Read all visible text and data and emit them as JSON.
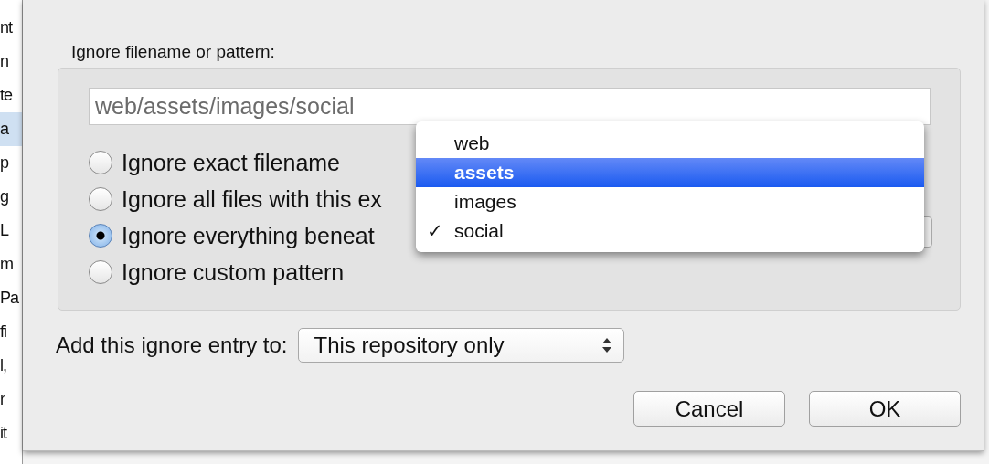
{
  "background_window": {
    "fragments": [
      {
        "text": "nt",
        "selected": false
      },
      {
        "text": "n",
        "selected": false
      },
      {
        "text": "te",
        "selected": false
      },
      {
        "text": "a",
        "selected": true
      },
      {
        "text": "p",
        "selected": false
      },
      {
        "text": "g",
        "selected": false
      },
      {
        "text": "L",
        "selected": false
      },
      {
        "text": "m",
        "selected": false
      },
      {
        "text": "Pa",
        "selected": false
      },
      {
        "text": "fi",
        "selected": false
      },
      {
        "text": "l,",
        "selected": false
      },
      {
        "text": "r",
        "selected": false
      },
      {
        "text": "it",
        "selected": false
      }
    ]
  },
  "dialog": {
    "field_label": "Ignore filename or pattern:",
    "pattern_value": "web/assets/images/social",
    "options": [
      {
        "label": "Ignore exact filename",
        "selected": false
      },
      {
        "label": "Ignore all files with this ex",
        "selected": false
      },
      {
        "label": "Ignore everything beneat",
        "selected": true
      },
      {
        "label": "Ignore custom pattern",
        "selected": false
      }
    ],
    "check_mark": "✓",
    "path_menu": [
      {
        "label": "web",
        "selected": false,
        "checked": false
      },
      {
        "label": "assets",
        "selected": true,
        "checked": false
      },
      {
        "label": "images",
        "selected": false,
        "checked": false
      },
      {
        "label": "social",
        "selected": false,
        "checked": true
      }
    ],
    "target_label": "Add this ignore entry to:",
    "target_value": "This repository only",
    "buttons": [
      "Cancel",
      "OK"
    ]
  }
}
